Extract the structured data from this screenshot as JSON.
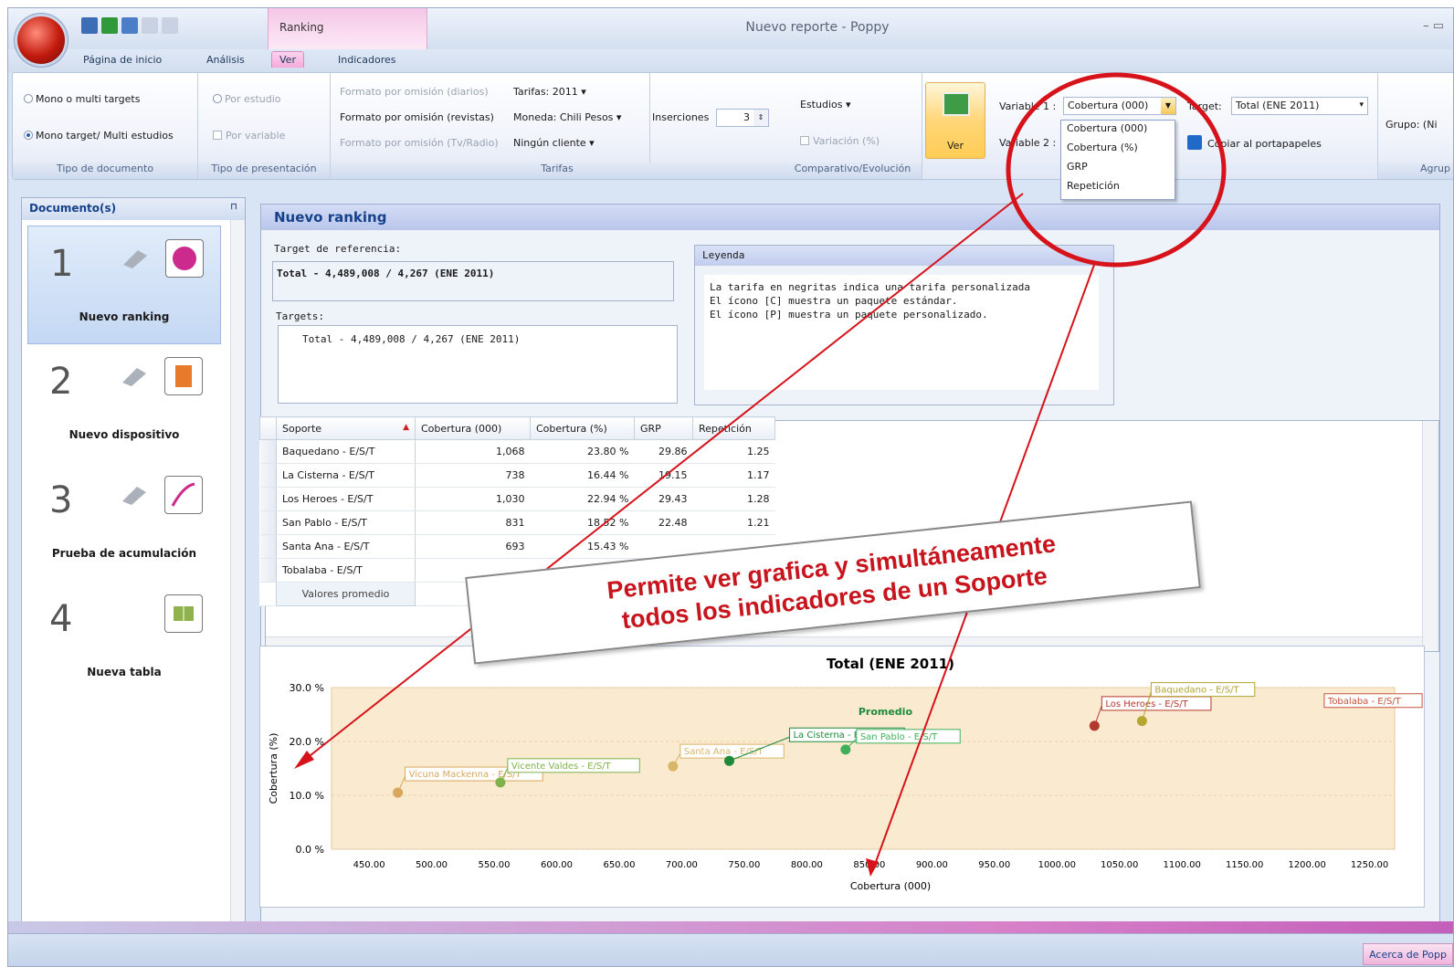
{
  "window": {
    "title": "Nuevo reporte - Poppy",
    "controls": "– ▭"
  },
  "context_tab": "Ranking",
  "tabs": [
    "Página de inicio",
    "Análisis",
    "Ver",
    "Indicadores"
  ],
  "ribbon": {
    "tipo_documento": {
      "opt1": "Mono o multi targets",
      "opt2": "Mono target/ Multi estudios",
      "label": "Tipo de documento"
    },
    "tipo_presentacion": {
      "opt1": "Por estudio",
      "opt2": "Por variable",
      "label": "Tipo de presentación"
    },
    "formatos": {
      "f1": "Formato por omisión (diarios)",
      "f2": "Formato por omisión (revistas)",
      "f3": "Formato por omisión (Tv/Radio)"
    },
    "tarifas": {
      "tarifas": "Tarifas: 2011 ▾",
      "moneda": "Moneda: Chili Pesos ▾",
      "cliente": "Ningún cliente ▾",
      "inserciones_label": "Inserciones",
      "inserciones_value": "3",
      "label": "Tarifas"
    },
    "comparativo": {
      "estudios": "Estudios ▾",
      "variacion": "Variación (%)",
      "label": "Comparativo/Evolución"
    },
    "ver_button": "Ver",
    "variable1_label": "Variable 1 :",
    "variable1_value": "Cobertura (000)",
    "variable2_label": "Variable 2 :",
    "variable_options": [
      "Cobertura (000)",
      "Cobertura (%)",
      "GRP",
      "Repetición"
    ],
    "target_label": "Target:",
    "target_value": "Total (ENE 2011)",
    "copiar": "Copiar al portapapeles",
    "grupo": "Grupo: (Ni",
    "agrup_label": "Agrup"
  },
  "left_panel": {
    "title": "Documento(s)",
    "docs": [
      {
        "num": "1",
        "label": "Nuevo ranking"
      },
      {
        "num": "2",
        "label": "Nuevo dispositivo"
      },
      {
        "num": "3",
        "label": "Prueba de acumulación"
      },
      {
        "num": "4",
        "label": "Nueva tabla"
      }
    ]
  },
  "main": {
    "title": "Nuevo ranking",
    "target_ref_label": "Target de referencia:",
    "target_ref_value": "Total - 4,489,008 / 4,267 (ENE 2011)",
    "targets_label": "Targets:",
    "targets_value": "Total - 4,489,008 / 4,267 (ENE 2011)",
    "leyenda_title": "Leyenda",
    "leyenda_lines": [
      "La tarifa en negritas indica una tarifa personalizada",
      "El ícono [C] muestra un paquete estándar.",
      "El ícono [P] muestra un paquete personalizado."
    ]
  },
  "grid": {
    "columns": [
      "Soporte",
      "Cobertura (000)",
      "Cobertura (%)",
      "GRP",
      "Repetición"
    ],
    "rows": [
      [
        "Baquedano - E/S/T",
        "1,068",
        "23.80 %",
        "29.86",
        "1.25"
      ],
      [
        "La Cisterna - E/S/T",
        "738",
        "16.44 %",
        "19.15",
        "1.17"
      ],
      [
        "Los Heroes - E/S/T",
        "1,030",
        "22.94 %",
        "29.43",
        "1.28"
      ],
      [
        "San Pablo - E/S/T",
        "831",
        "18.52 %",
        "22.48",
        "1.21"
      ],
      [
        "Santa Ana - E/S/T",
        "693",
        "15.43 %",
        "",
        ""
      ],
      [
        "Tobalaba - E/S/T",
        "",
        "",
        "",
        ""
      ]
    ],
    "footer": "Valores promedio"
  },
  "chart_data": {
    "type": "scatter",
    "title": "Total (ENE 2011)",
    "xlabel": "Cobertura (000)",
    "ylabel": "Cobertura (%)",
    "xlim": [
      420,
      1270
    ],
    "ylim": [
      0,
      30
    ],
    "xticks": [
      "450.00",
      "500.00",
      "550.00",
      "600.00",
      "650.00",
      "700.00",
      "750.00",
      "800.00",
      "850.00",
      "900.00",
      "950.00",
      "1000.00",
      "1050.00",
      "1100.00",
      "1150.00",
      "1200.00",
      "1250.00"
    ],
    "yticks": [
      "0.0 %",
      "10.0 %",
      "20.0 %",
      "30.0 %"
    ],
    "points": [
      {
        "label": "Vicuna Mackenna - E/S/T",
        "x": 473,
        "y": 10.5,
        "color": "#d9a75a"
      },
      {
        "label": "Vicente Valdes - E/S/T",
        "x": 555,
        "y": 12.4,
        "color": "#7fb24b"
      },
      {
        "label": "Santa Ana - E/S/T",
        "x": 693,
        "y": 15.4,
        "color": "#d9b567"
      },
      {
        "label": "La Cisterna - E/S/T",
        "x": 738,
        "y": 16.4,
        "color": "#1e8a3a"
      },
      {
        "label": "San Pablo - E/S/T",
        "x": 831,
        "y": 18.5,
        "color": "#3fb05a"
      },
      {
        "label": "Los Heroes - E/S/T",
        "x": 1030,
        "y": 22.9,
        "color": "#b4382e"
      },
      {
        "label": "Baquedano - E/S/T",
        "x": 1068,
        "y": 23.8,
        "color": "#b5a533"
      },
      {
        "label": "Tobalaba - E/S/T",
        "x": 1240,
        "y": 27.5,
        "color": "#c4523a"
      }
    ],
    "promedio_label": "Promedio"
  },
  "callout": {
    "line1": "Permite ver grafica y simultáneamente",
    "line2": "todos los indicadores de un Soporte"
  },
  "statusbar": {
    "acerca": "Acerca de Popp"
  }
}
